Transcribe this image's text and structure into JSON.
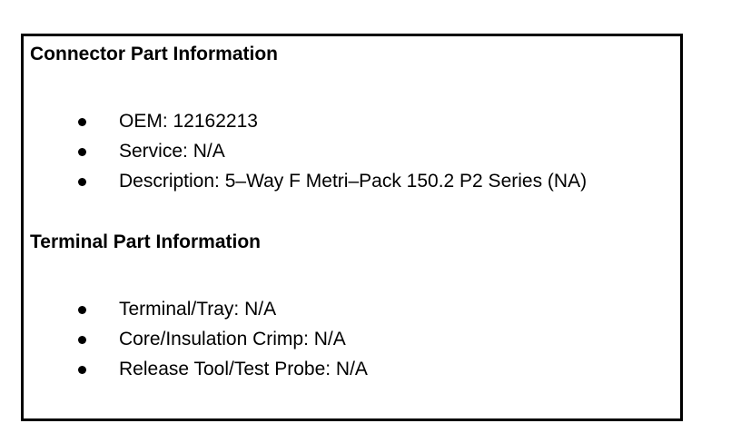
{
  "connector_section": {
    "heading": "Connector Part Information",
    "items": [
      {
        "label": "OEM: 12162213"
      },
      {
        "label": "Service: N/A"
      },
      {
        "label": "Description: 5–Way F Metri–Pack 150.2 P2 Series (NA)"
      }
    ]
  },
  "terminal_section": {
    "heading": "Terminal Part Information",
    "items": [
      {
        "label": "Terminal/Tray: N/A"
      },
      {
        "label": "Core/Insulation Crimp: N/A"
      },
      {
        "label": "Release Tool/Test Probe: N/A"
      }
    ]
  },
  "icons": {
    "bullet": "bullet-dot-icon"
  },
  "colors": {
    "text": "#000000",
    "border": "#000000",
    "background": "#ffffff"
  }
}
